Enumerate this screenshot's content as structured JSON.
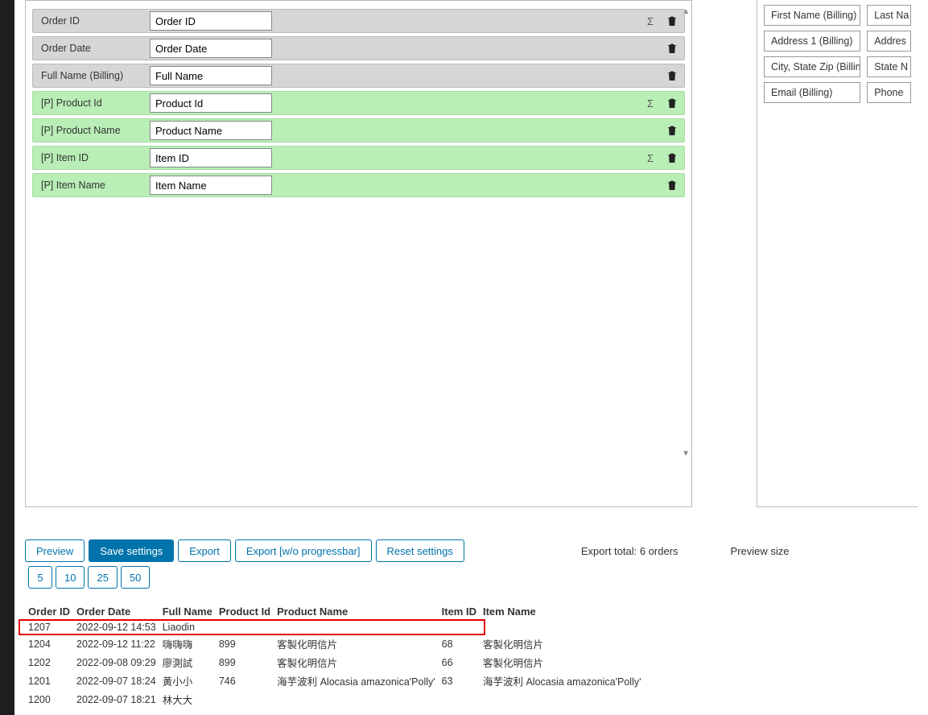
{
  "fields": [
    {
      "label": "Order ID",
      "value": "Order ID",
      "type": "gray",
      "sigma": true
    },
    {
      "label": "Order Date",
      "value": "Order Date",
      "type": "gray",
      "sigma": false
    },
    {
      "label": "Full Name (Billing)",
      "value": "Full Name",
      "type": "gray",
      "sigma": false
    },
    {
      "label": "[P] Product Id",
      "value": "Product Id",
      "type": "green",
      "sigma": true
    },
    {
      "label": "[P] Product Name",
      "value": "Product Name",
      "type": "green",
      "sigma": false
    },
    {
      "label": "[P] Item ID",
      "value": "Item ID",
      "type": "green",
      "sigma": true
    },
    {
      "label": "[P] Item Name",
      "value": "Item Name",
      "type": "green",
      "sigma": false
    }
  ],
  "available": {
    "row1a": "First Name (Billing)",
    "row1b": "Last Na",
    "row2a": "Address 1 (Billing)",
    "row2b": "Addres",
    "row3a": "City, State Zip (Billing)",
    "row3b": "State N",
    "row4a": "Email (Billing)",
    "row4b": "Phone"
  },
  "toolbar": {
    "preview": "Preview",
    "save": "Save settings",
    "export": "Export",
    "export_wo": "Export [w/o progressbar]",
    "reset": "Reset settings",
    "export_total": "Export total: 6 orders",
    "preview_size_label": "Preview size",
    "sizes": [
      "5",
      "10",
      "25",
      "50"
    ]
  },
  "table": {
    "headers": [
      "Order ID",
      "Order Date",
      "Full Name",
      "Product Id",
      "Product Name",
      "Item ID",
      "Item Name"
    ],
    "rows": [
      {
        "id": "1207",
        "date": "2022-09-12 14:53",
        "name": "Liaodin",
        "pid": "",
        "pname": "",
        "iid": "",
        "iname": "",
        "highlight": true
      },
      {
        "id": "1204",
        "date": "2022-09-12 11:22",
        "name": "嗨嗨嗨",
        "pid": "899",
        "pname": "客製化明信片",
        "iid": "68",
        "iname": "客製化明信片"
      },
      {
        "id": "1202",
        "date": "2022-09-08 09:29",
        "name": "廖測試",
        "pid": "899",
        "pname": "客製化明信片",
        "iid": "66",
        "iname": "客製化明信片"
      },
      {
        "id": "1201",
        "date": "2022-09-07 18:24",
        "name": "黃小小",
        "pid": "746",
        "pname": "海芋波利 Alocasia amazonica'Polly'",
        "iid": "63",
        "iname": "海芋波利 Alocasia amazonica'Polly'"
      },
      {
        "id": "1200",
        "date": "2022-09-07 18:21",
        "name": "林大大",
        "pid": "",
        "pname": "",
        "iid": "",
        "iname": ""
      }
    ]
  }
}
